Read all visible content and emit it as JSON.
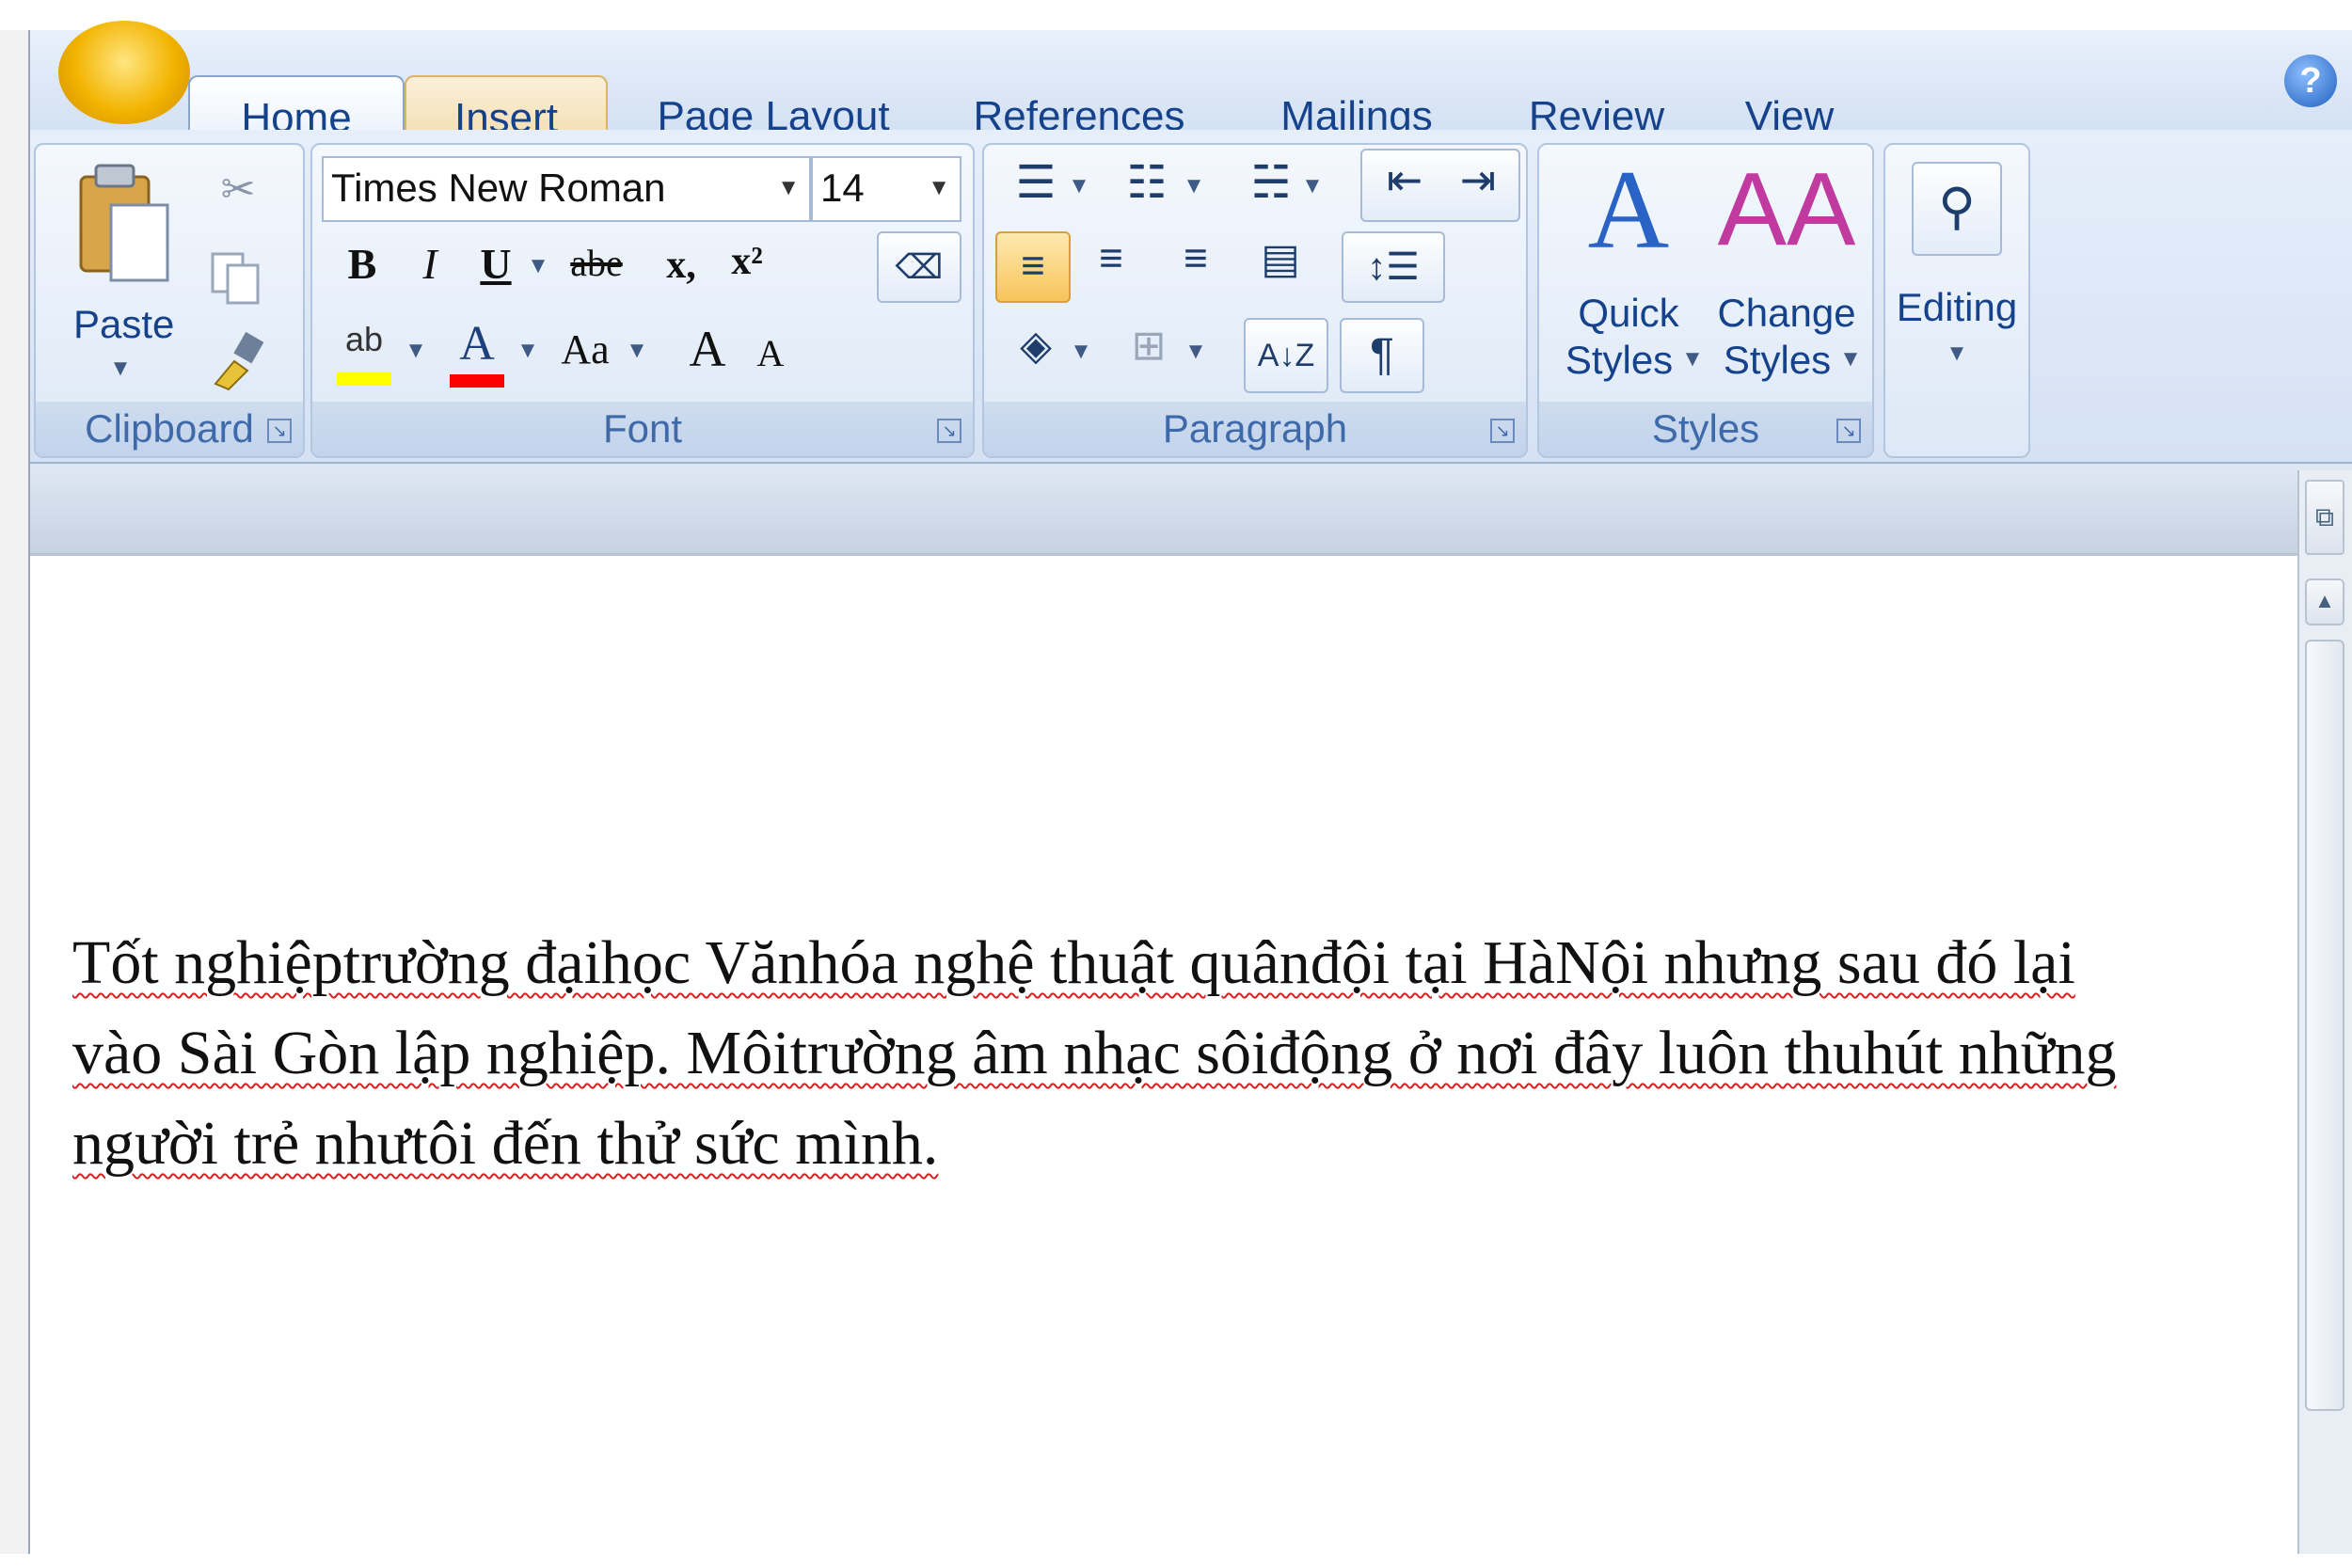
{
  "tabs": [
    "Home",
    "Insert",
    "Page Layout",
    "References",
    "Mailings",
    "Review",
    "View"
  ],
  "help": "?",
  "clipboard": {
    "paste": "Paste",
    "group": "Clipboard"
  },
  "font": {
    "name": "Times New Roman",
    "size": "14",
    "bold": "B",
    "italic": "I",
    "underline": "U",
    "strike": "abe",
    "subscript": "x,",
    "superscript": "x²",
    "highlight": "ab",
    "color": "A",
    "case": "Aa",
    "grow": "A",
    "shrink": "A",
    "group": "Font"
  },
  "paragraph": {
    "group": "Paragraph",
    "pilcrow": "¶",
    "sort": "A↓Z"
  },
  "styles": {
    "quick1": "Quick",
    "quick2": "Styles",
    "change1": "Change",
    "change2": "Styles",
    "group": "Styles"
  },
  "editing": {
    "label": "Editing"
  },
  "colors": {
    "ribbon": "#d5e2f4",
    "accent": "#15428b",
    "highlight": "#ffff00",
    "font_color": "#ff0000",
    "squiggle": "#d92020"
  },
  "document": {
    "line1": "Tốt nghiệptrường đạihọc Vănhóa nghệ thuật quânđội tại HàNội nhưng sau đó lại",
    "line2": "vào Sài Gòn lập nghiệp. Môitrường âm nhạc sôiđộng ở nơi đây luôn thuhút những",
    "line3": "người trẻ nhưtôi đến thử sức mình."
  }
}
